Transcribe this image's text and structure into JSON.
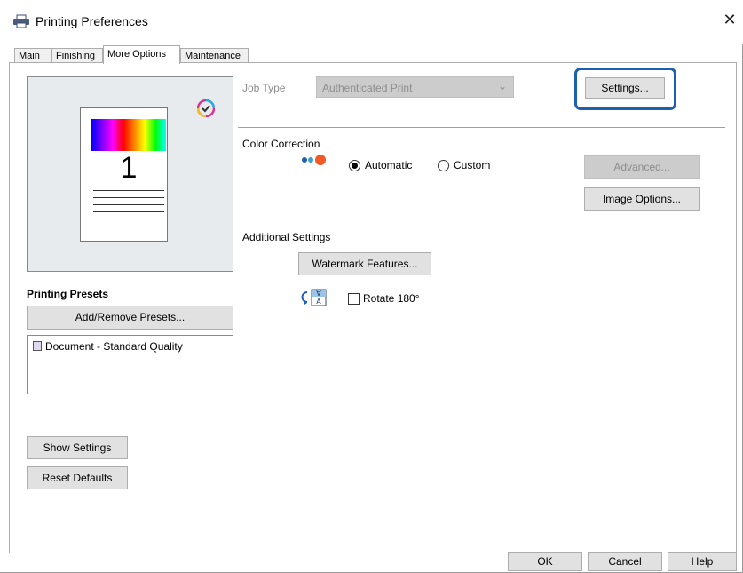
{
  "window": {
    "title": "Printing Preferences",
    "close_glyph": "✕"
  },
  "tabs": [
    {
      "label": "Main",
      "active": false
    },
    {
      "label": "Finishing",
      "active": false
    },
    {
      "label": "More Options",
      "active": true
    },
    {
      "label": "Maintenance",
      "active": false
    }
  ],
  "preview": {
    "page_number": "1"
  },
  "job_type": {
    "label": "Job Type",
    "value": "Authenticated Print",
    "settings_button": "Settings..."
  },
  "color_correction": {
    "label": "Color Correction",
    "option_automatic": "Automatic",
    "option_custom": "Custom",
    "selected": "Automatic",
    "advanced_button": "Advanced...",
    "image_options_button": "Image Options..."
  },
  "additional_settings": {
    "label": "Additional Settings",
    "watermark_button": "Watermark Features...",
    "rotate_label": "Rotate 180°",
    "rotate_checked": false
  },
  "presets": {
    "heading": "Printing Presets",
    "add_remove_button": "Add/Remove Presets...",
    "items": [
      "Document - Standard Quality"
    ]
  },
  "left_buttons": {
    "show_settings": "Show Settings",
    "reset_defaults": "Reset Defaults"
  },
  "footer": {
    "ok": "OK",
    "cancel": "Cancel",
    "help": "Help"
  },
  "colors": {
    "highlight_ring": "#1e5fb4"
  }
}
